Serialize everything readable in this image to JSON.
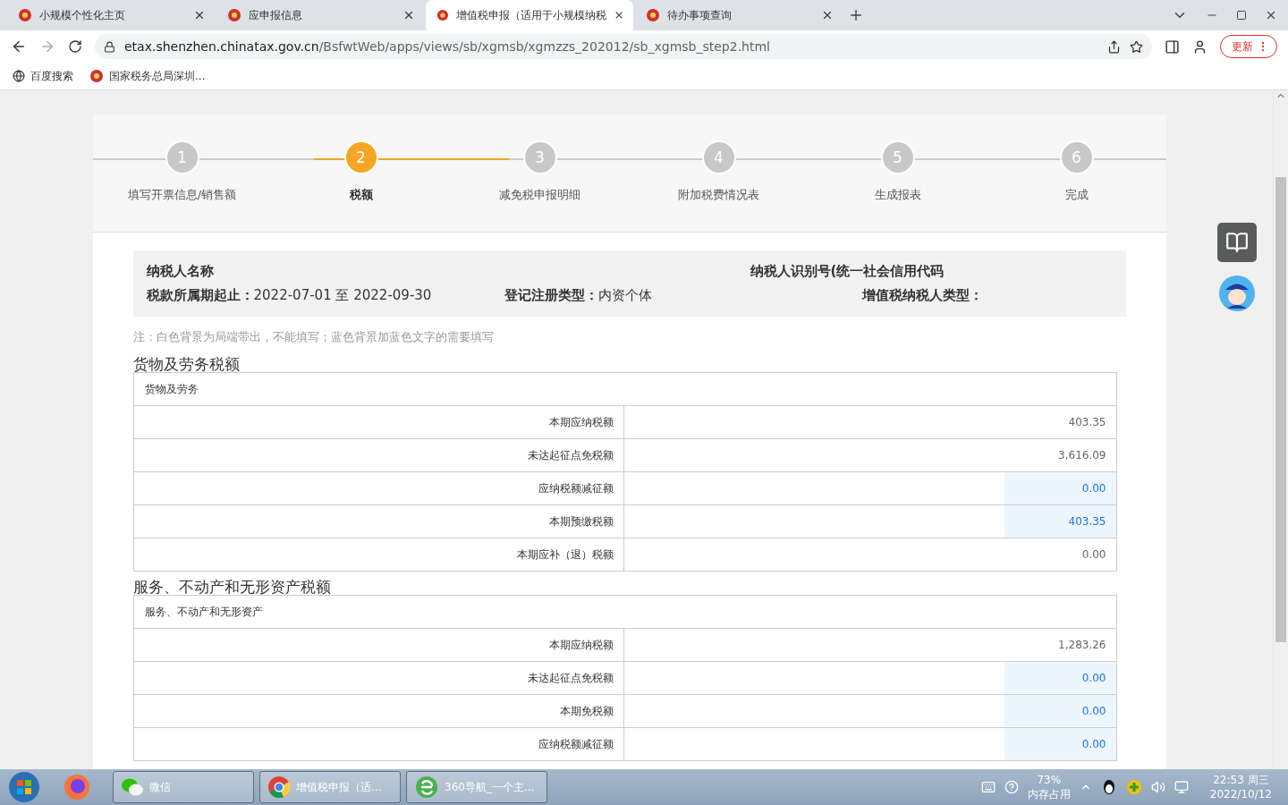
{
  "tabs": [
    {
      "title": "小规模个性化主页",
      "selected": false
    },
    {
      "title": "应申报信息",
      "selected": false
    },
    {
      "title": "增值税申报（适用于小规模纳税",
      "selected": true
    },
    {
      "title": "待办事项查询",
      "selected": false
    }
  ],
  "address": {
    "host": "etax.shenzhen.chinatax.gov.cn",
    "path": "/BsfwtWeb/apps/views/sb/xgmsb/xgmzzs_202012/sb_xgmsb_step2.html"
  },
  "update_button": "更新",
  "bookmarks": [
    {
      "label": "百度搜索",
      "kind": "globe"
    },
    {
      "label": "国家税务总局深圳...",
      "kind": "emblem"
    }
  ],
  "steps": [
    {
      "number": "1",
      "label": "填写开票信息/销售额",
      "selected": false
    },
    {
      "number": "2",
      "label": "税额",
      "selected": true
    },
    {
      "number": "3",
      "label": "减免税申报明细",
      "selected": false
    },
    {
      "number": "4",
      "label": "附加税费情况表",
      "selected": false
    },
    {
      "number": "5",
      "label": "生成报表",
      "selected": false
    },
    {
      "number": "6",
      "label": "完成",
      "selected": false
    }
  ],
  "info": {
    "name_label": "纳税人名称",
    "id_label": "纳税人识别号(统一社会信用代码",
    "period_label": "税款所属期起止：",
    "period_value": "2022-07-01 至 2022-09-30",
    "reg_label": "登记注册类型：",
    "reg_value": "内资个体",
    "type_label": "增值税纳税人类型："
  },
  "note": "注：白色背景为局端带出，不能填写；蓝色背景加蓝色文字的需要填写",
  "sections": [
    {
      "title": "货物及劳务税额",
      "header": "货物及劳务",
      "rows": [
        {
          "label": "本期应纳税额",
          "value": "403.35",
          "editable": false
        },
        {
          "label": "未达起征点免税额",
          "value": "3,616.09",
          "editable": false
        },
        {
          "label": "应纳税额减征额",
          "value": "0.00",
          "editable": true
        },
        {
          "label": "本期预缴税额",
          "value": "403.35",
          "editable": true
        },
        {
          "label": "本期应补（退）税额",
          "value": "0.00",
          "editable": false
        }
      ]
    },
    {
      "title": "服务、不动产和无形资产税额",
      "header": "服务、不动产和无形资产",
      "rows": [
        {
          "label": "本期应纳税额",
          "value": "1,283.26",
          "editable": false
        },
        {
          "label": "未达起征点免税额",
          "value": "0.00",
          "editable": true
        },
        {
          "label": "本期免税额",
          "value": "0.00",
          "editable": true
        },
        {
          "label": "应纳税额减征额",
          "value": "0.00",
          "editable": true
        }
      ]
    }
  ],
  "taskbar": [
    {
      "label": "微信",
      "kind": "wechat"
    },
    {
      "label": "增值税申报（适...",
      "kind": "chrome"
    },
    {
      "label": "360导航_一个主...",
      "kind": "ie"
    }
  ],
  "tray": {
    "memory_percent": "73%",
    "memory_label": "内存占用",
    "time": "22:53 周三",
    "date": "2022/10/12"
  }
}
